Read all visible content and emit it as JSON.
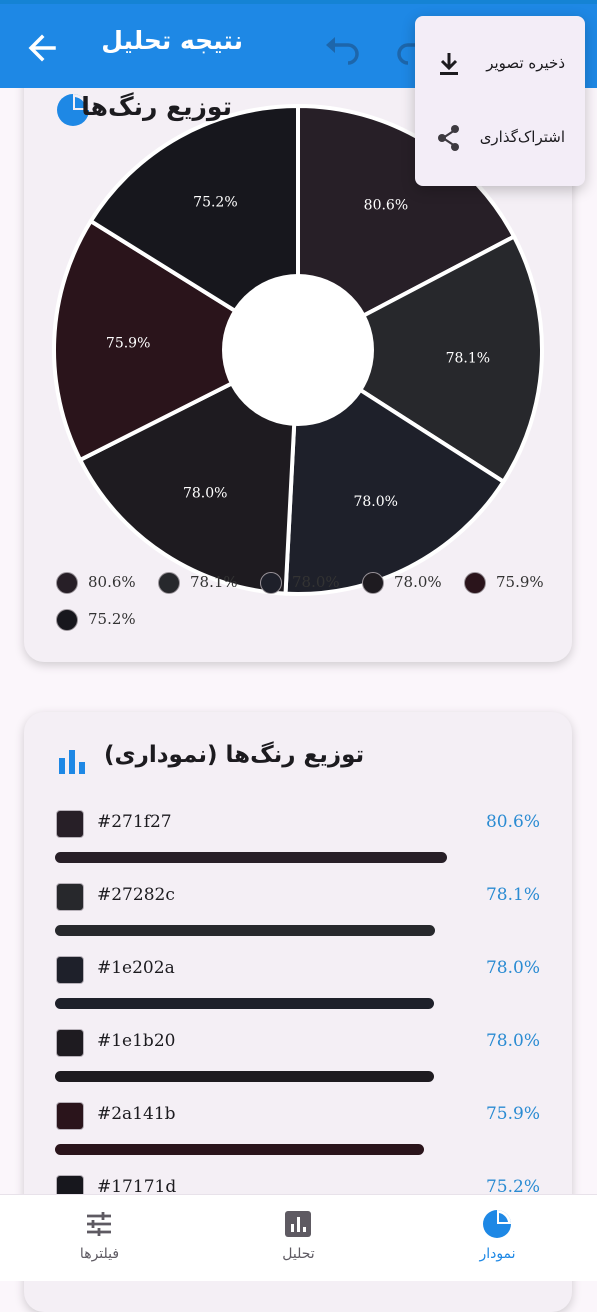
{
  "appbar": {
    "title": "نتیجه تحلیل"
  },
  "pie_card": {
    "title": "توزیع رنگ‌ها"
  },
  "bar_card": {
    "title": "توزیع رنگ‌ها (نموداری)"
  },
  "menu": {
    "save_label": "ذخیره تصویر",
    "share_label": "اشتراک‌گذاری"
  },
  "nav": {
    "filters": "فیلترها",
    "analysis": "تحلیل",
    "chart": "نمودار"
  },
  "colors": {
    "accent": "#1e88e5",
    "percent_text": "#2a8bd2"
  },
  "chart_data": [
    {
      "type": "pie",
      "title": "توزیع رنگ‌ها",
      "slices": [
        {
          "label": "80.6%",
          "value": 80.6,
          "color": "#271f27"
        },
        {
          "label": "78.1%",
          "value": 78.1,
          "color": "#27282c"
        },
        {
          "label": "78.0%",
          "value": 78.0,
          "color": "#1e202a"
        },
        {
          "label": "78.0%",
          "value": 78.0,
          "color": "#1e1b20"
        },
        {
          "label": "75.9%",
          "value": 75.9,
          "color": "#2a141b"
        },
        {
          "label": "75.2%",
          "value": 75.2,
          "color": "#17171d"
        }
      ],
      "legend": [
        "80.6%",
        "78.1%",
        "78.0%",
        "78.0%",
        "75.9%",
        "75.2%"
      ]
    },
    {
      "type": "bar",
      "title": "توزیع رنگ‌ها (نموداری)",
      "rows": [
        {
          "hex": "#271f27",
          "percent": "80.6%",
          "value": 80.6
        },
        {
          "hex": "#27282c",
          "percent": "78.1%",
          "value": 78.1
        },
        {
          "hex": "#1e202a",
          "percent": "78.0%",
          "value": 78.0
        },
        {
          "hex": "#1e1b20",
          "percent": "78.0%",
          "value": 78.0
        },
        {
          "hex": "#2a141b",
          "percent": "75.9%",
          "value": 75.9
        },
        {
          "hex": "#17171d",
          "percent": "75.2%",
          "value": 75.2
        }
      ]
    }
  ]
}
